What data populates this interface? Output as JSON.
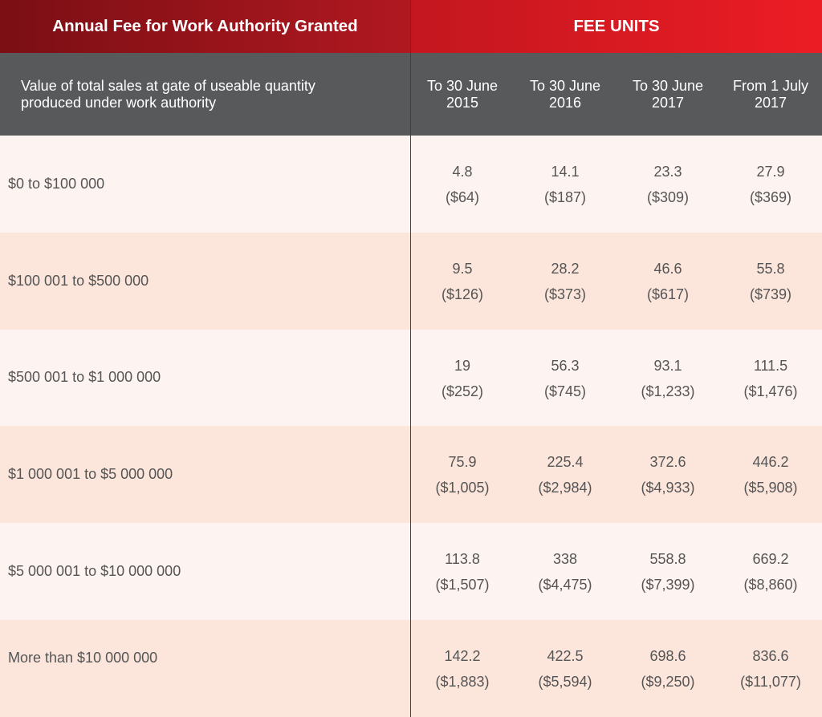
{
  "title": {
    "left": "Annual Fee for Work Authority Granted",
    "right": "FEE UNITS"
  },
  "header": {
    "label": "Value of total sales at gate of useable quantity produced under work authority",
    "columns": [
      {
        "line1": "To 30 June",
        "line2": "2015"
      },
      {
        "line1": "To 30 June",
        "line2": "2016"
      },
      {
        "line1": "To 30 June",
        "line2": "2017"
      },
      {
        "line1": "From 1 July",
        "line2": "2017"
      }
    ]
  },
  "rows": [
    {
      "label": "$0 to $100 000",
      "cells": [
        {
          "units": "4.8",
          "dollars": "($64)"
        },
        {
          "units": "14.1",
          "dollars": "($187)"
        },
        {
          "units": "23.3",
          "dollars": "($309)"
        },
        {
          "units": "27.9",
          "dollars": "($369)"
        }
      ]
    },
    {
      "label": "$100 001 to $500 000",
      "cells": [
        {
          "units": "9.5",
          "dollars": "($126)"
        },
        {
          "units": "28.2",
          "dollars": "($373)"
        },
        {
          "units": "46.6",
          "dollars": "($617)"
        },
        {
          "units": "55.8",
          "dollars": "($739)"
        }
      ]
    },
    {
      "label": "$500 001 to $1 000 000",
      "cells": [
        {
          "units": "19",
          "dollars": "($252)"
        },
        {
          "units": "56.3",
          "dollars": "($745)"
        },
        {
          "units": "93.1",
          "dollars": "($1,233)"
        },
        {
          "units": "111.5",
          "dollars": "($1,476)"
        }
      ]
    },
    {
      "label": "$1 000 001 to $5 000 000",
      "cells": [
        {
          "units": "75.9",
          "dollars": "($1,005)"
        },
        {
          "units": "225.4",
          "dollars": "($2,984)"
        },
        {
          "units": "372.6",
          "dollars": "($4,933)"
        },
        {
          "units": "446.2",
          "dollars": "($5,908)"
        }
      ]
    },
    {
      "label": "$5 000 001 to $10 000 000",
      "cells": [
        {
          "units": "113.8",
          "dollars": "($1,507)"
        },
        {
          "units": "338",
          "dollars": "($4,475)"
        },
        {
          "units": "558.8",
          "dollars": "($7,399)"
        },
        {
          "units": "669.2",
          "dollars": "($8,860)"
        }
      ]
    },
    {
      "label": "More than $10 000 000",
      "cells": [
        {
          "units": "142.2",
          "dollars": "($1,883)"
        },
        {
          "units": "422.5",
          "dollars": "($5,594)"
        },
        {
          "units": "698.6",
          "dollars": "($9,250)"
        },
        {
          "units": "836.6",
          "dollars": "($11,077)"
        }
      ]
    }
  ],
  "colors": {
    "title_left": "#9e141b",
    "title_right": "#ec1c24",
    "header_bg": "#58595b",
    "row_light": "#fdf3f0",
    "row_dark": "#fce6dc",
    "text": "#555555"
  }
}
